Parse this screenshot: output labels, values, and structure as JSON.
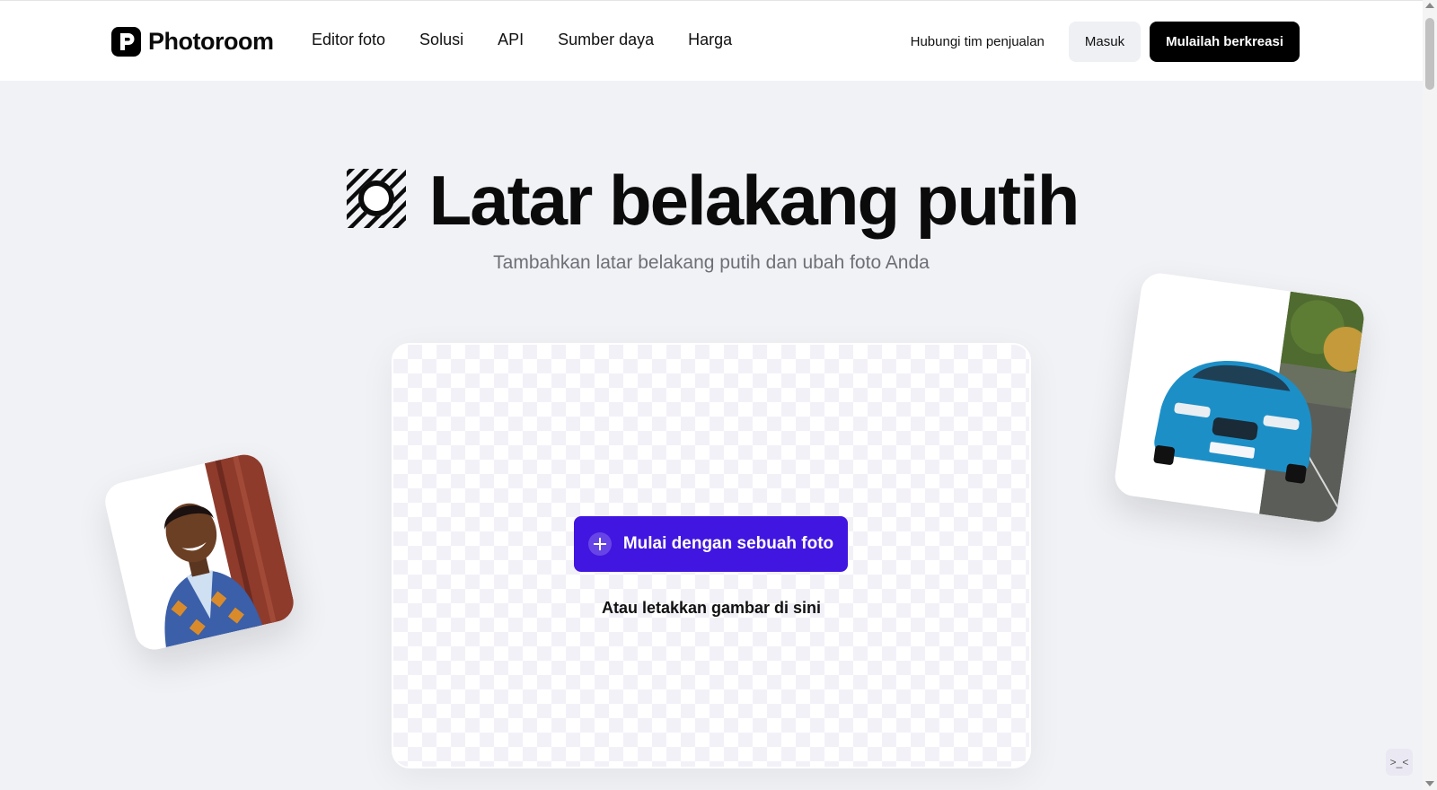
{
  "header": {
    "logo_text": "Photoroom",
    "nav": [
      {
        "label": "Editor foto"
      },
      {
        "label": "Solusi"
      },
      {
        "label": "API"
      },
      {
        "label": "Sumber daya"
      },
      {
        "label": "Harga"
      }
    ],
    "sales_link": "Hubungi tim penjualan",
    "login_label": "Masuk",
    "start_label": "Mulailah berkreasi"
  },
  "hero": {
    "title": "Latar belakang putih",
    "subtitle": "Tambahkan latar belakang putih dan ubah foto Anda",
    "title_icon": "white-background-icon"
  },
  "upload": {
    "button_label": "Mulai dengan sebuah foto",
    "drop_hint": "Atau letakkan gambar di sini",
    "accent_color": "#4116e0"
  },
  "corner_widget": {
    "text": ">_<"
  },
  "colors": {
    "page_bg": "#f1f2f6",
    "header_bg": "#ffffff",
    "primary_dark": "#000000"
  }
}
